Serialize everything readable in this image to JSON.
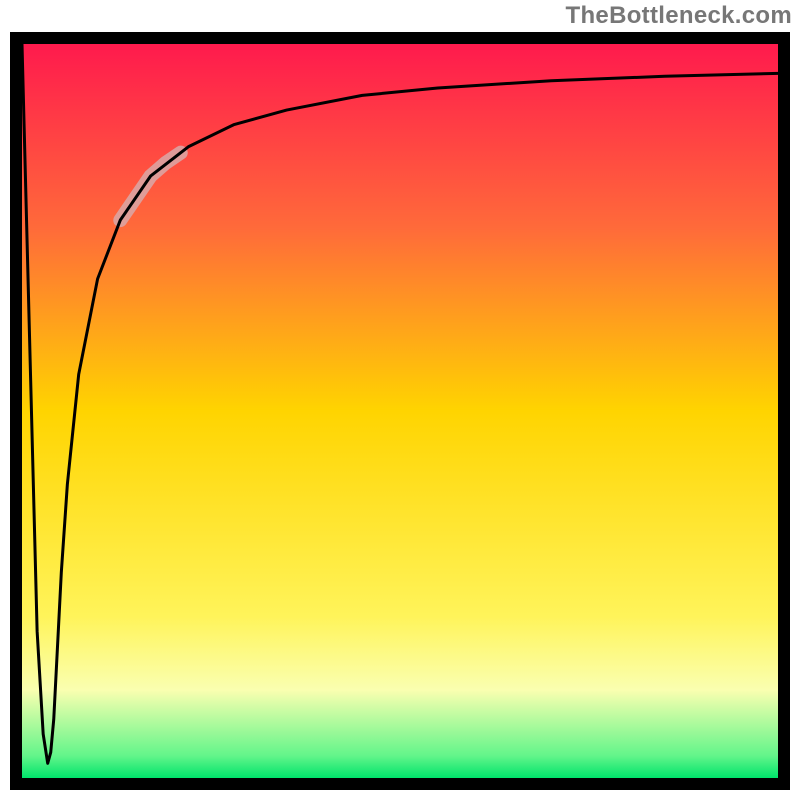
{
  "watermark": "TheBottleneck.com",
  "chart_data": {
    "type": "line",
    "title": "",
    "xlabel": "",
    "ylabel": "",
    "xlim": [
      0,
      100
    ],
    "ylim": [
      0,
      100
    ],
    "grid": false,
    "legend": false,
    "background_gradient": {
      "direction": "vertical",
      "stops": [
        {
          "pos": 0.0,
          "color": "#ff1a4d"
        },
        {
          "pos": 0.25,
          "color": "#ff6a3a"
        },
        {
          "pos": 0.5,
          "color": "#ffd400"
        },
        {
          "pos": 0.78,
          "color": "#fff45a"
        },
        {
          "pos": 0.88,
          "color": "#faffb0"
        },
        {
          "pos": 0.97,
          "color": "#62f58a"
        },
        {
          "pos": 1.0,
          "color": "#00e36b"
        }
      ]
    },
    "series": [
      {
        "name": "bottleneck-curve",
        "color": "#000000",
        "stroke_width": 3,
        "x": [
          0.0,
          1.0,
          2.0,
          2.8,
          3.4,
          3.8,
          4.2,
          4.6,
          5.2,
          6.0,
          7.5,
          10.0,
          13.0,
          17.0,
          22.0,
          28.0,
          35.0,
          45.0,
          55.0,
          70.0,
          85.0,
          100.0
        ],
        "y": [
          100.0,
          60.0,
          20.0,
          6.0,
          2.0,
          3.5,
          8.0,
          16.0,
          28.0,
          40.0,
          55.0,
          68.0,
          76.0,
          82.0,
          86.0,
          89.0,
          91.0,
          93.0,
          94.0,
          95.0,
          95.6,
          96.0
        ]
      },
      {
        "name": "highlight-segment",
        "color": "#d9a8a8",
        "stroke_width": 14,
        "opacity": 0.85,
        "x": [
          13.0,
          15.0,
          17.0,
          19.0,
          21.0
        ],
        "y": [
          76.0,
          79.0,
          82.0,
          83.8,
          85.2
        ]
      }
    ],
    "annotations": []
  }
}
